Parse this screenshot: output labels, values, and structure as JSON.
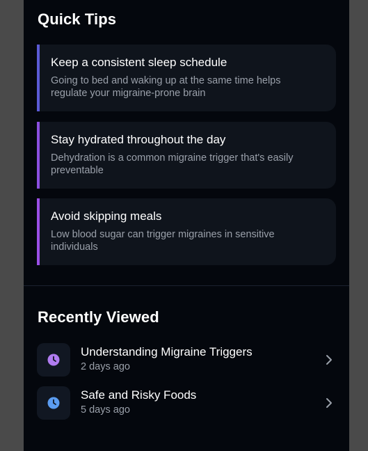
{
  "quick_tips": {
    "title": "Quick Tips",
    "items": [
      {
        "title": "Keep a consistent sleep schedule",
        "description": "Going to bed and waking up at the same time helps regulate your migraine-prone brain",
        "accent": "#5b5bd6"
      },
      {
        "title": "Stay hydrated throughout the day",
        "description": "Dehydration is a common migraine trigger that's easily preventable",
        "accent": "#8b4fe0"
      },
      {
        "title": "Avoid skipping meals",
        "description": "Low blood sugar can trigger migraines in sensitive individuals",
        "accent": "#9a4fe6"
      }
    ]
  },
  "recently_viewed": {
    "title": "Recently Viewed",
    "items": [
      {
        "title": "Understanding Migraine Triggers",
        "meta": "2 days ago",
        "icon": "clock-icon",
        "icon_color": "#b07cf0"
      },
      {
        "title": "Safe and Risky Foods",
        "meta": "5 days ago",
        "icon": "clock-icon",
        "icon_color": "#5b9cf0"
      }
    ]
  }
}
